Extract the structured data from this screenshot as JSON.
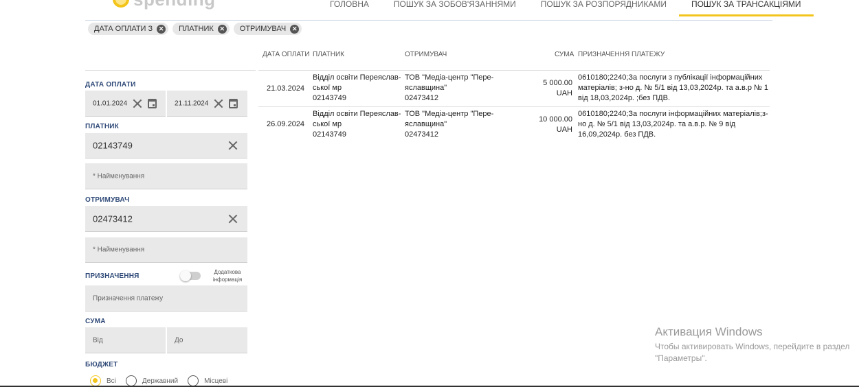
{
  "header": {
    "logo_text": "spending",
    "nav": [
      {
        "label": "ГОЛОВНА"
      },
      {
        "label": "ПОШУК ЗА ЗОБОВ'ЯЗАННЯМИ"
      },
      {
        "label": "ПОШУК ЗА РОЗПОРЯДНИКАМИ"
      },
      {
        "label": "ПОШУК ЗА ТРАНСАКЦІЯМИ",
        "active": true
      }
    ]
  },
  "chips": [
    {
      "label": "ДАТА ОПЛАТИ З"
    },
    {
      "label": "ПЛАТНИК"
    },
    {
      "label": "ОТРИМУВАЧ"
    }
  ],
  "filters": {
    "date_label": "ДАТА ОПЛАТИ",
    "date_from": "01.01.2024",
    "date_to": "21.11.2024",
    "payer_label": "ПЛАТНИК",
    "payer_code": "02143749",
    "payer_name_placeholder": "* Найменування",
    "recipient_label": "ОТРИМУВАЧ",
    "recipient_code": "02473412",
    "recipient_name_placeholder": "* Найменування",
    "purpose_label": "ПРИЗНАЧЕННЯ",
    "additional_info_toggle": "Додаткова інформація",
    "purpose_placeholder": "Призначення платежу",
    "amount_label": "СУМА",
    "amount_from_placeholder": "Від",
    "amount_to_placeholder": "До",
    "budget_label": "БЮДЖЕТ",
    "budget_options": [
      "Всі",
      "Державний",
      "Місцеві"
    ],
    "budget_selected": "Всі"
  },
  "table": {
    "columns": [
      "ДАТА ОПЛАТИ",
      "ПЛАТНИК",
      "ОТРИМУВАЧ",
      "СУМА",
      "ПРИЗНАЧЕННЯ ПЛАТЕЖУ"
    ],
    "rows": [
      {
        "date": "21.03.2024",
        "payer_name_1": "Відділ освіти Переяслав-",
        "payer_name_2": "ської мр",
        "payer_code": "02143749",
        "recipient_name_1": "ТОВ \"Медіа-центр \"Пере-",
        "recipient_name_2": "яславщина\"",
        "recipient_code": "02473412",
        "amount": "5 000.00",
        "currency": "UAH",
        "purpose_1": "0610180;2240;За послуги з публікації інформаційних",
        "purpose_2": "матеріалів; з-но д. № 5/1 від 13,03,2024р. та а.в.р № 1",
        "purpose_3": "від 18,03,2024р. ;без ПДВ."
      },
      {
        "date": "26.09.2024",
        "payer_name_1": "Відділ освіти Переяслав-",
        "payer_name_2": "ської мр",
        "payer_code": "02143749",
        "recipient_name_1": "ТОВ \"Медіа-центр \"Пере-",
        "recipient_name_2": "яславщина\"",
        "recipient_code": "02473412",
        "amount": "10 000.00",
        "currency": "UAH",
        "purpose_1": "0610180;2240;За послуги інформаційних матеріалів;з-",
        "purpose_2": "но д. № 5/1 від 13,03,2024р. та а.в.р. № 9 від",
        "purpose_3": "16,09,2024р. без ПДВ."
      }
    ]
  },
  "watermark": {
    "title": "Активация Windows",
    "line1": "Чтобы активировать Windows, перейдите в раздел",
    "line2": "\"Параметры\"."
  },
  "colors": {
    "accent": "#f3c51b",
    "label": "#2f4a78",
    "field_bg": "#e9e9ea"
  }
}
